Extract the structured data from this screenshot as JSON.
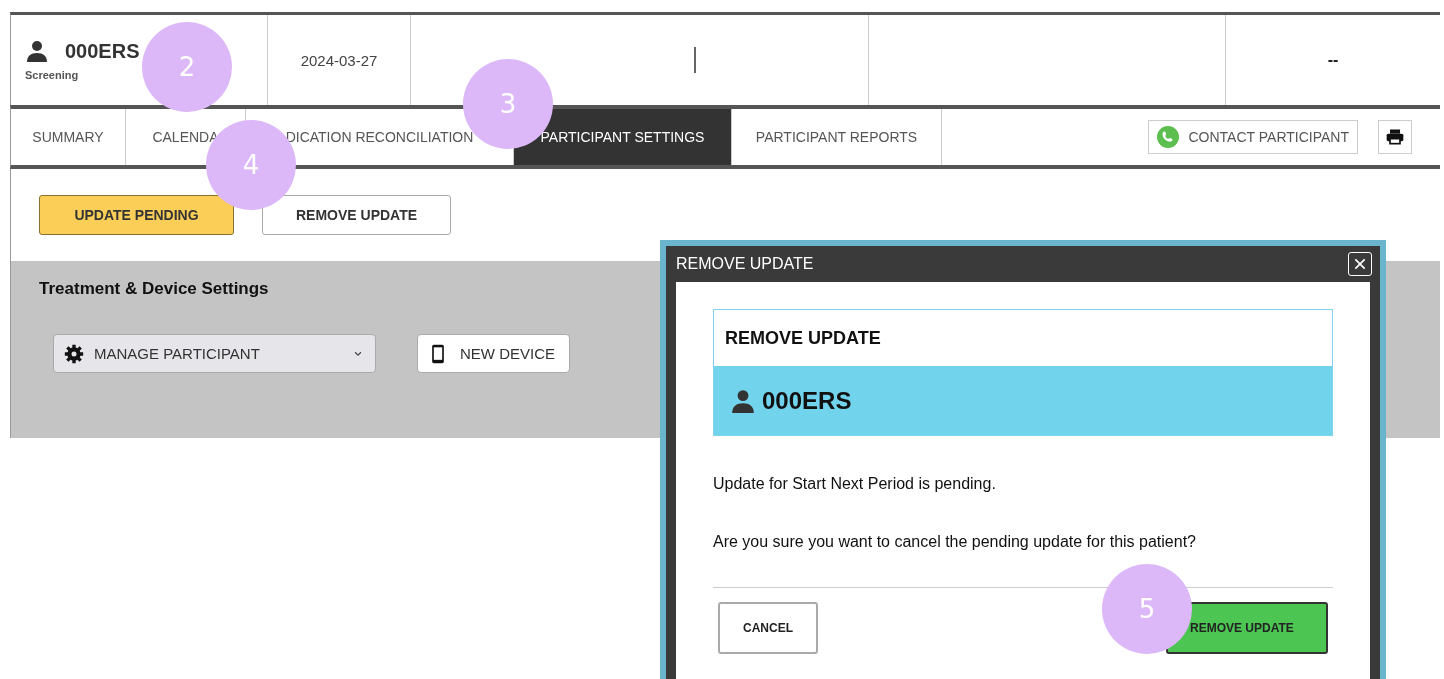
{
  "header": {
    "participant_id": "000ERS",
    "status": "Screening",
    "date": "2024-03-27",
    "column_5": "--"
  },
  "tabs": [
    {
      "label": "SUMMARY",
      "selected": false
    },
    {
      "label": "CALENDA",
      "selected": false
    },
    {
      "label": "DICATION RECONCILIATION",
      "selected": false
    },
    {
      "label": "PARTICIPANT SETTINGS",
      "selected": true
    },
    {
      "label": "PARTICIPANT REPORTS",
      "selected": false
    }
  ],
  "contact_button": "CONTACT PARTICIPANT",
  "action_buttons": [
    {
      "label": "UPDATE PENDING",
      "kind": "pending"
    },
    {
      "label": "REMOVE UPDATE",
      "kind": "plain"
    }
  ],
  "settings": {
    "title": "Treatment & Device Settings",
    "manage_select": "MANAGE PARTICIPANT",
    "new_device_button": "NEW DEVICE"
  },
  "modal": {
    "title": "REMOVE UPDATE",
    "card_title": "REMOVE UPDATE",
    "participant_id": "000ERS",
    "messages": [
      "Update for Start Next Period is pending.",
      "Are you sure you want to cancel the pending update for this patient?"
    ],
    "buttons": [
      {
        "label": "CANCEL",
        "kind": "secondary"
      },
      {
        "label": "REMOVE UPDATE",
        "kind": "primary"
      }
    ]
  },
  "callouts": [
    {
      "number": "2"
    },
    {
      "number": "3"
    },
    {
      "number": "4"
    },
    {
      "number": "5"
    }
  ]
}
